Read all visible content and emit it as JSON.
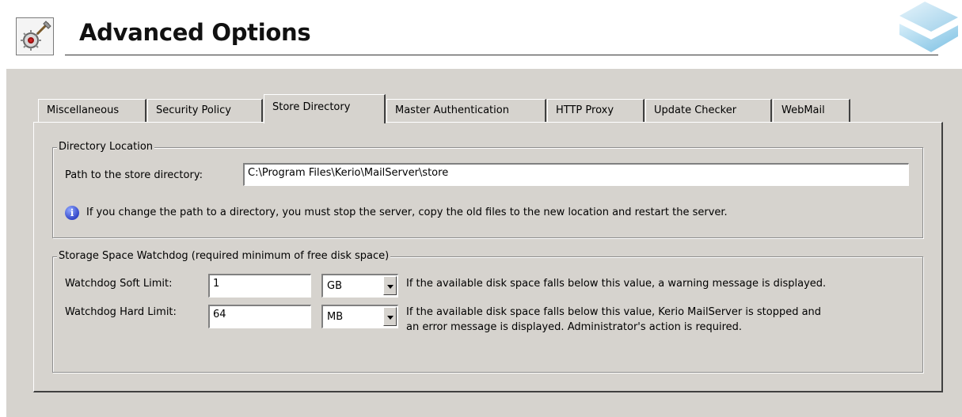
{
  "header": {
    "title": "Advanced Options",
    "icon": "tools-gear-icon",
    "logo": "kerio-logo-icon"
  },
  "tabs": [
    {
      "label": "Miscellaneous",
      "active": false
    },
    {
      "label": "Security Policy",
      "active": false
    },
    {
      "label": "Store Directory",
      "active": true
    },
    {
      "label": "Master Authentication",
      "active": false
    },
    {
      "label": "HTTP Proxy",
      "active": false
    },
    {
      "label": "Update Checker",
      "active": false
    },
    {
      "label": "WebMail",
      "active": false
    }
  ],
  "directory_location": {
    "title": "Directory Location",
    "path_label": "Path to the store directory:",
    "path_value": "C:\\Program Files\\Kerio\\MailServer\\store",
    "info_icon": "info-icon",
    "info_text": "If you change the path to a directory, you must stop the server, copy the old files to the new location and restart the server."
  },
  "watchdog": {
    "title": "Storage Space Watchdog (required minimum of free disk space)",
    "soft": {
      "label": "Watchdog Soft Limit:",
      "value": "1",
      "unit": "GB",
      "description": "If the available disk space falls below this value, a warning message is displayed."
    },
    "hard": {
      "label": "Watchdog Hard Limit:",
      "value": "64",
      "unit": "MB",
      "description_line1": "If the available disk space falls below this value, Kerio MailServer is stopped and",
      "description_line2": "an error message is displayed. Administrator's action is required."
    }
  },
  "colors": {
    "dialog_bg": "#d6d3ce",
    "info_blue": "#3346c8"
  }
}
